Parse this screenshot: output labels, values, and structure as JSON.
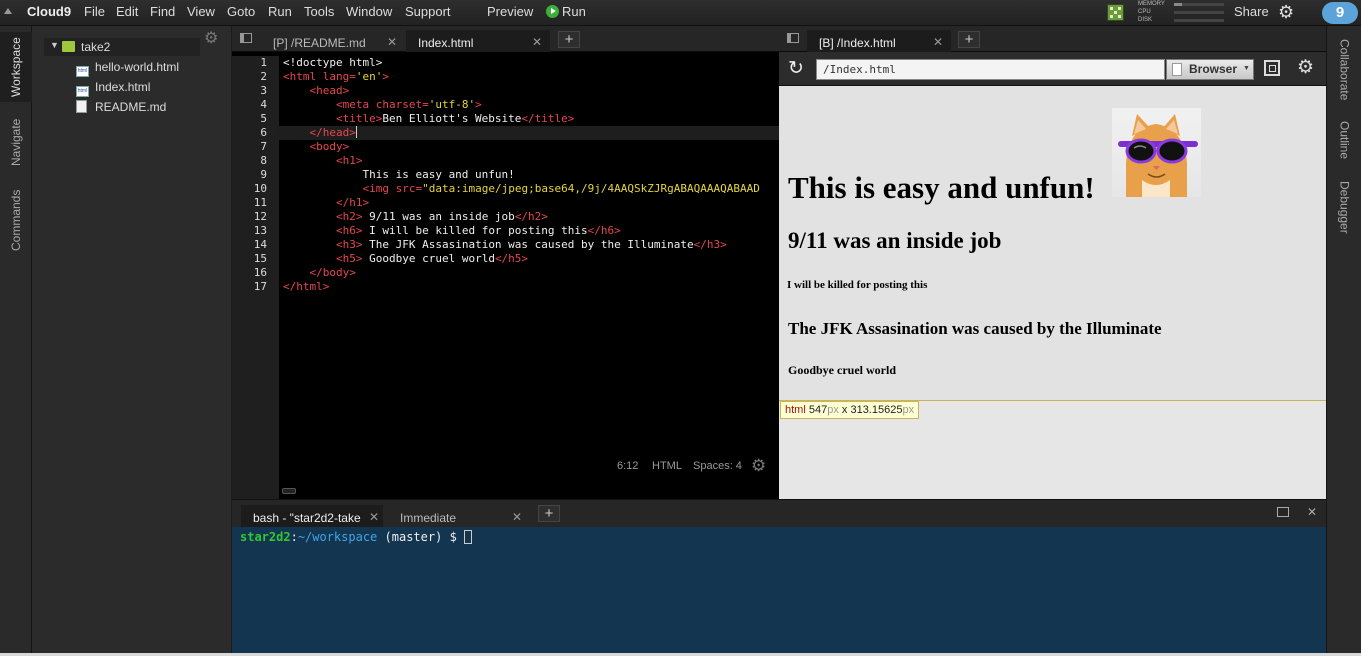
{
  "menubar": {
    "brand": "Cloud9",
    "items": [
      "File",
      "Edit",
      "Find",
      "View",
      "Goto",
      "Run",
      "Tools",
      "Window",
      "Support"
    ],
    "preview": "Preview",
    "run": "Run",
    "meters": [
      "MEMORY",
      "CPU",
      "DISK"
    ],
    "share": "Share",
    "avatar": "9"
  },
  "leftbar": {
    "tabs": [
      "Workspace",
      "Navigate",
      "Commands"
    ]
  },
  "tree": {
    "root": "take2",
    "files": [
      {
        "name": "hello-world.html",
        "icon": "html-file-icon"
      },
      {
        "name": "Index.html",
        "icon": "html-file-icon"
      },
      {
        "name": "README.md",
        "icon": "text-file-icon"
      }
    ]
  },
  "editor": {
    "tabs": [
      "[P] /README.md",
      "Index.html"
    ],
    "status": {
      "cursor": "6:12",
      "mode": "HTML",
      "spaces": "Spaces: 4"
    }
  },
  "code": [
    [
      [
        "t",
        "<!doctype html>"
      ]
    ],
    [
      [
        "g",
        "<html "
      ],
      [
        "a",
        "lang="
      ],
      [
        "s",
        "'en'"
      ],
      [
        "g",
        ">"
      ]
    ],
    [
      [
        "t",
        "    "
      ],
      [
        "g",
        "<head>"
      ]
    ],
    [
      [
        "t",
        "        "
      ],
      [
        "g",
        "<meta "
      ],
      [
        "a",
        "charset="
      ],
      [
        "s",
        "'utf-8'"
      ],
      [
        "g",
        ">"
      ]
    ],
    [
      [
        "t",
        "        "
      ],
      [
        "g",
        "<title>"
      ],
      [
        "t",
        "Ben Elliott's Website"
      ],
      [
        "g",
        "</title>"
      ]
    ],
    [
      [
        "t",
        "    "
      ],
      [
        "g",
        "</head>"
      ]
    ],
    [
      [
        "t",
        "    "
      ],
      [
        "g",
        "<body>"
      ]
    ],
    [
      [
        "t",
        "        "
      ],
      [
        "g",
        "<h1>"
      ]
    ],
    [
      [
        "t",
        "            This is easy and unfun!"
      ]
    ],
    [
      [
        "t",
        "            "
      ],
      [
        "g",
        "<img "
      ],
      [
        "a",
        "src="
      ],
      [
        "s",
        "\"data:image/jpeg;base64,/9j/4AAQSkZJRgABAQAAAQABAAD"
      ]
    ],
    [
      [
        "t",
        "        "
      ],
      [
        "g",
        "</h1>"
      ]
    ],
    [
      [
        "t",
        "        "
      ],
      [
        "g",
        "<h2>"
      ],
      [
        "t",
        " 9/11 was an inside job"
      ],
      [
        "g",
        "</h2>"
      ]
    ],
    [
      [
        "t",
        "        "
      ],
      [
        "g",
        "<h6>"
      ],
      [
        "t",
        " I will be killed for posting this"
      ],
      [
        "g",
        "</h6>"
      ]
    ],
    [
      [
        "t",
        "        "
      ],
      [
        "g",
        "<h3>"
      ],
      [
        "t",
        " The JFK Assasination was caused by the Illuminate"
      ],
      [
        "g",
        "</h3>"
      ]
    ],
    [
      [
        "t",
        "        "
      ],
      [
        "g",
        "<h5>"
      ],
      [
        "t",
        " Goodbye cruel world"
      ],
      [
        "g",
        "</h5>"
      ]
    ],
    [
      [
        "t",
        "    "
      ],
      [
        "g",
        "</body>"
      ]
    ],
    [
      [
        "g",
        "</html>"
      ]
    ]
  ],
  "preview": {
    "tab": "[B] /Index.html",
    "url": "/Index.html",
    "browser": "Browser",
    "h1": "This is easy and unfun!",
    "h2": "9/11 was an inside job",
    "h6": "I will be killed for posting this",
    "h3": "The JFK Assasination was caused by the Illuminate",
    "h5": "Goodbye cruel world",
    "inspector": {
      "tag": "html",
      "w": "547",
      "h": "313.15625",
      "unit": "px",
      "x": "x"
    }
  },
  "rightbar": {
    "tabs": [
      "Collaborate",
      "Outline",
      "Debugger"
    ]
  },
  "terminal": {
    "tabs": [
      "bash - \"star2d2-take",
      "Immediate"
    ],
    "user": "star2d2",
    "path": "~/workspace",
    "branch": "(master)",
    "prompt": "$"
  },
  "colors": {
    "accent": "#3cae3c",
    "terminal_bg": "#133550",
    "prompt_user": "#32c832",
    "prompt_path": "#3fa6e8"
  }
}
